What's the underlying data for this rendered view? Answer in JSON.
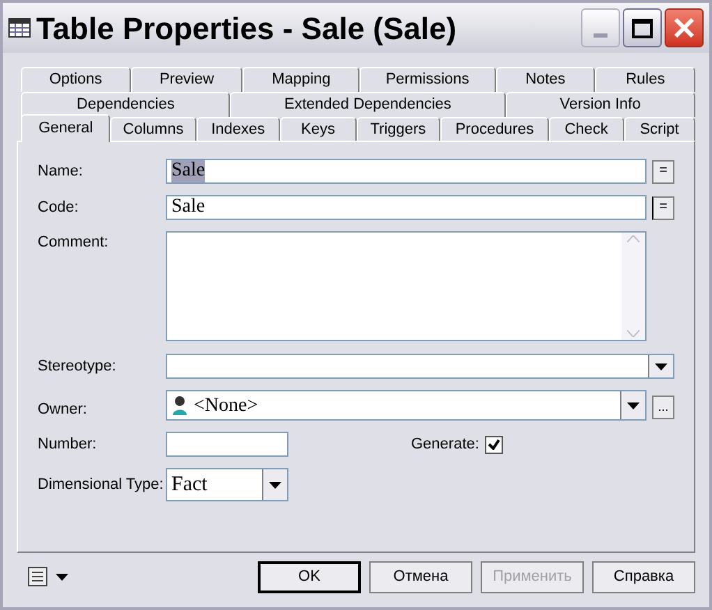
{
  "window": {
    "title": "Table Properties - Sale (Sale)"
  },
  "tab_rows": [
    [
      {
        "label": "Options",
        "selected": false
      },
      {
        "label": "Preview",
        "selected": false
      },
      {
        "label": "Mapping",
        "selected": false
      },
      {
        "label": "Permissions",
        "selected": false
      },
      {
        "label": "Notes",
        "selected": false
      },
      {
        "label": "Rules",
        "selected": false
      }
    ],
    [
      {
        "label": "Dependencies",
        "selected": false
      },
      {
        "label": "Extended Dependencies",
        "selected": false
      },
      {
        "label": "Version Info",
        "selected": false
      }
    ],
    [
      {
        "label": "General",
        "selected": true
      },
      {
        "label": "Columns",
        "selected": false
      },
      {
        "label": "Indexes",
        "selected": false
      },
      {
        "label": "Keys",
        "selected": false
      },
      {
        "label": "Triggers",
        "selected": false
      },
      {
        "label": "Procedures",
        "selected": false
      },
      {
        "label": "Check",
        "selected": false
      },
      {
        "label": "Script",
        "selected": false
      }
    ]
  ],
  "form": {
    "name": {
      "label": "Name:",
      "value": "Sale",
      "button": "="
    },
    "code": {
      "label": "Code:",
      "value": "Sale",
      "button": "="
    },
    "comment": {
      "label": "Comment:"
    },
    "stereotype": {
      "label": "Stereotype:"
    },
    "owner": {
      "label": "Owner:",
      "value": "<None>",
      "button": "..."
    },
    "number": {
      "label": "Number:"
    },
    "generate": {
      "label": "Generate:",
      "checked": true
    },
    "dimensional_type": {
      "label": "Dimensional Type:",
      "value": "Fact"
    }
  },
  "buttons": [
    {
      "label": "OK",
      "disabled": false,
      "default": true
    },
    {
      "label": "Отмена",
      "disabled": false,
      "default": false
    },
    {
      "label": "Применить",
      "disabled": true,
      "default": false
    },
    {
      "label": "Справка",
      "disabled": false,
      "default": false
    }
  ]
}
